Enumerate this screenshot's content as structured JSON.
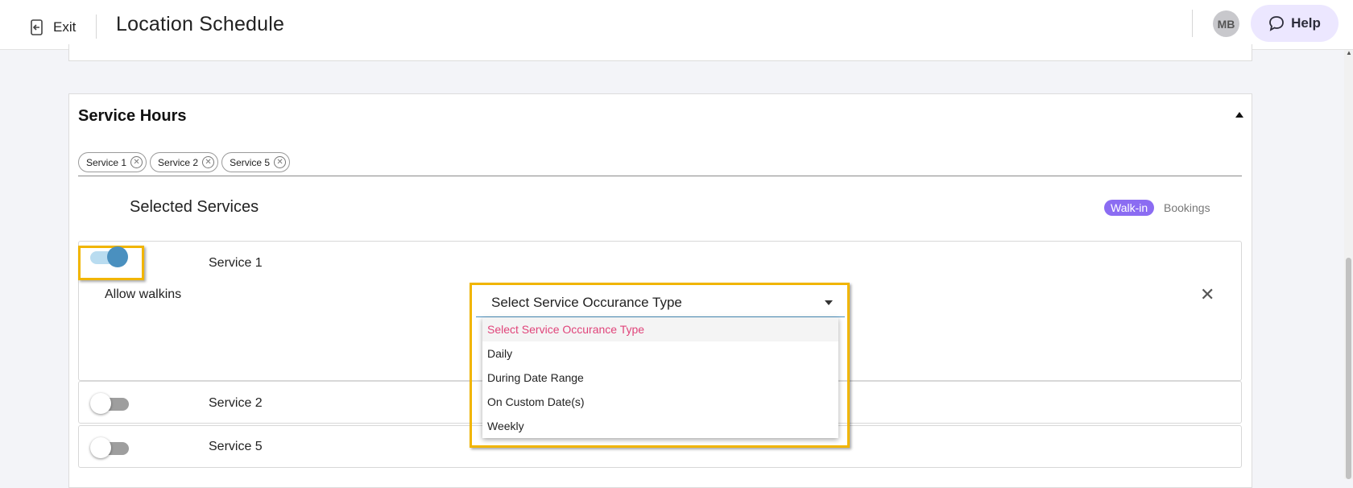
{
  "header": {
    "exit_label": "Exit",
    "title": "Location Schedule",
    "avatar_initials": "MB",
    "help_label": "Help"
  },
  "service_hours": {
    "title": "Service Hours",
    "chips": [
      "Service 1",
      "Service 2",
      "Service 5"
    ],
    "selected_title": "Selected Services",
    "toggle_walkin": "Walk-in",
    "toggle_bookings": "Bookings",
    "rows": [
      {
        "name": "Service 1",
        "enabled": true,
        "allow_label": "Allow walkins"
      },
      {
        "name": "Service 2",
        "enabled": false
      },
      {
        "name": "Service 5",
        "enabled": false
      }
    ],
    "occurrence_select": {
      "value": "Select Service Occurance Type",
      "options": [
        "Select Service Occurance Type",
        "Daily",
        "During Date Range",
        "On Custom Date(s)",
        "Weekly"
      ]
    }
  },
  "colors": {
    "highlight": "#f1b500",
    "walkin_pill": "#8b6cf2",
    "toggle_on": "#4a90bf",
    "placeholder_option": "#e0447a"
  }
}
